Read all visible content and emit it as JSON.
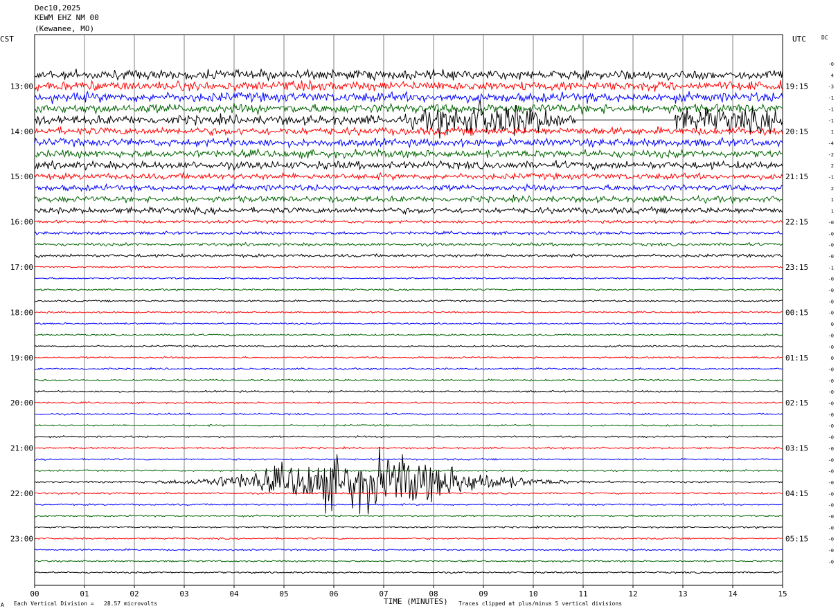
{
  "header": {
    "date": "Dec10,2025",
    "station": "KEWM EHZ NM 00",
    "location": "(Kewanee, MO)"
  },
  "axes": {
    "left_tz": "CST",
    "right_tz": "UTC",
    "dc_label": "DC",
    "xlabel": "TIME (MINUTES)"
  },
  "footer": {
    "corner_mark": "A",
    "scale_note": "Each Vertical Division =   28.57 microvolts",
    "clip_note": "Traces clipped at plus/minus 5 vertical divisions"
  },
  "colors": {
    "black": "#000000",
    "red": "#ff0000",
    "blue": "#0000ff",
    "green": "#006400",
    "grid": "#808080"
  },
  "chart_data": {
    "type": "helicorder",
    "x_range_minutes": [
      0,
      15
    ],
    "x_ticks": [
      "00",
      "01",
      "02",
      "03",
      "04",
      "05",
      "06",
      "07",
      "08",
      "09",
      "10",
      "11",
      "12",
      "13",
      "14",
      "15"
    ],
    "trace_color_cycle": [
      "black",
      "red",
      "blue",
      "green"
    ],
    "left_hour_labels": [
      {
        "row": 1,
        "text": "13:00"
      },
      {
        "row": 5,
        "text": "14:00"
      },
      {
        "row": 9,
        "text": "15:00"
      },
      {
        "row": 13,
        "text": "16:00"
      },
      {
        "row": 17,
        "text": "17:00"
      },
      {
        "row": 21,
        "text": "18:00"
      },
      {
        "row": 25,
        "text": "19:00"
      },
      {
        "row": 29,
        "text": "20:00"
      },
      {
        "row": 33,
        "text": "21:00"
      },
      {
        "row": 37,
        "text": "22:00"
      },
      {
        "row": 41,
        "text": "23:00"
      }
    ],
    "right_hour_labels": [
      {
        "row": 1,
        "text": "19:15"
      },
      {
        "row": 5,
        "text": "20:15"
      },
      {
        "row": 9,
        "text": "21:15"
      },
      {
        "row": 13,
        "text": "22:15"
      },
      {
        "row": 17,
        "text": "23:15"
      },
      {
        "row": 21,
        "text": "00:15"
      },
      {
        "row": 25,
        "text": "01:15"
      },
      {
        "row": 29,
        "text": "02:15"
      },
      {
        "row": 33,
        "text": "03:15"
      },
      {
        "row": 37,
        "text": "04:15"
      },
      {
        "row": 41,
        "text": "05:15"
      }
    ],
    "dc_offsets": [
      "-0",
      "4",
      "-3",
      "-1",
      "-1",
      "-1",
      "1",
      "-4",
      "-2",
      "2",
      "-1",
      "2",
      "1",
      "1",
      "-0",
      "-0",
      "-0",
      "-0",
      "-1",
      "-0",
      "-0",
      "-0",
      "-0",
      "0",
      "-0",
      "-0",
      "0",
      "-0",
      "-0",
      "-0",
      "-0",
      "-0",
      "-0",
      "-0",
      "-0",
      "-0",
      "-0",
      "-0",
      "-0",
      "-0",
      "-0",
      "-0",
      "-0",
      "-0",
      "-0"
    ]
  }
}
